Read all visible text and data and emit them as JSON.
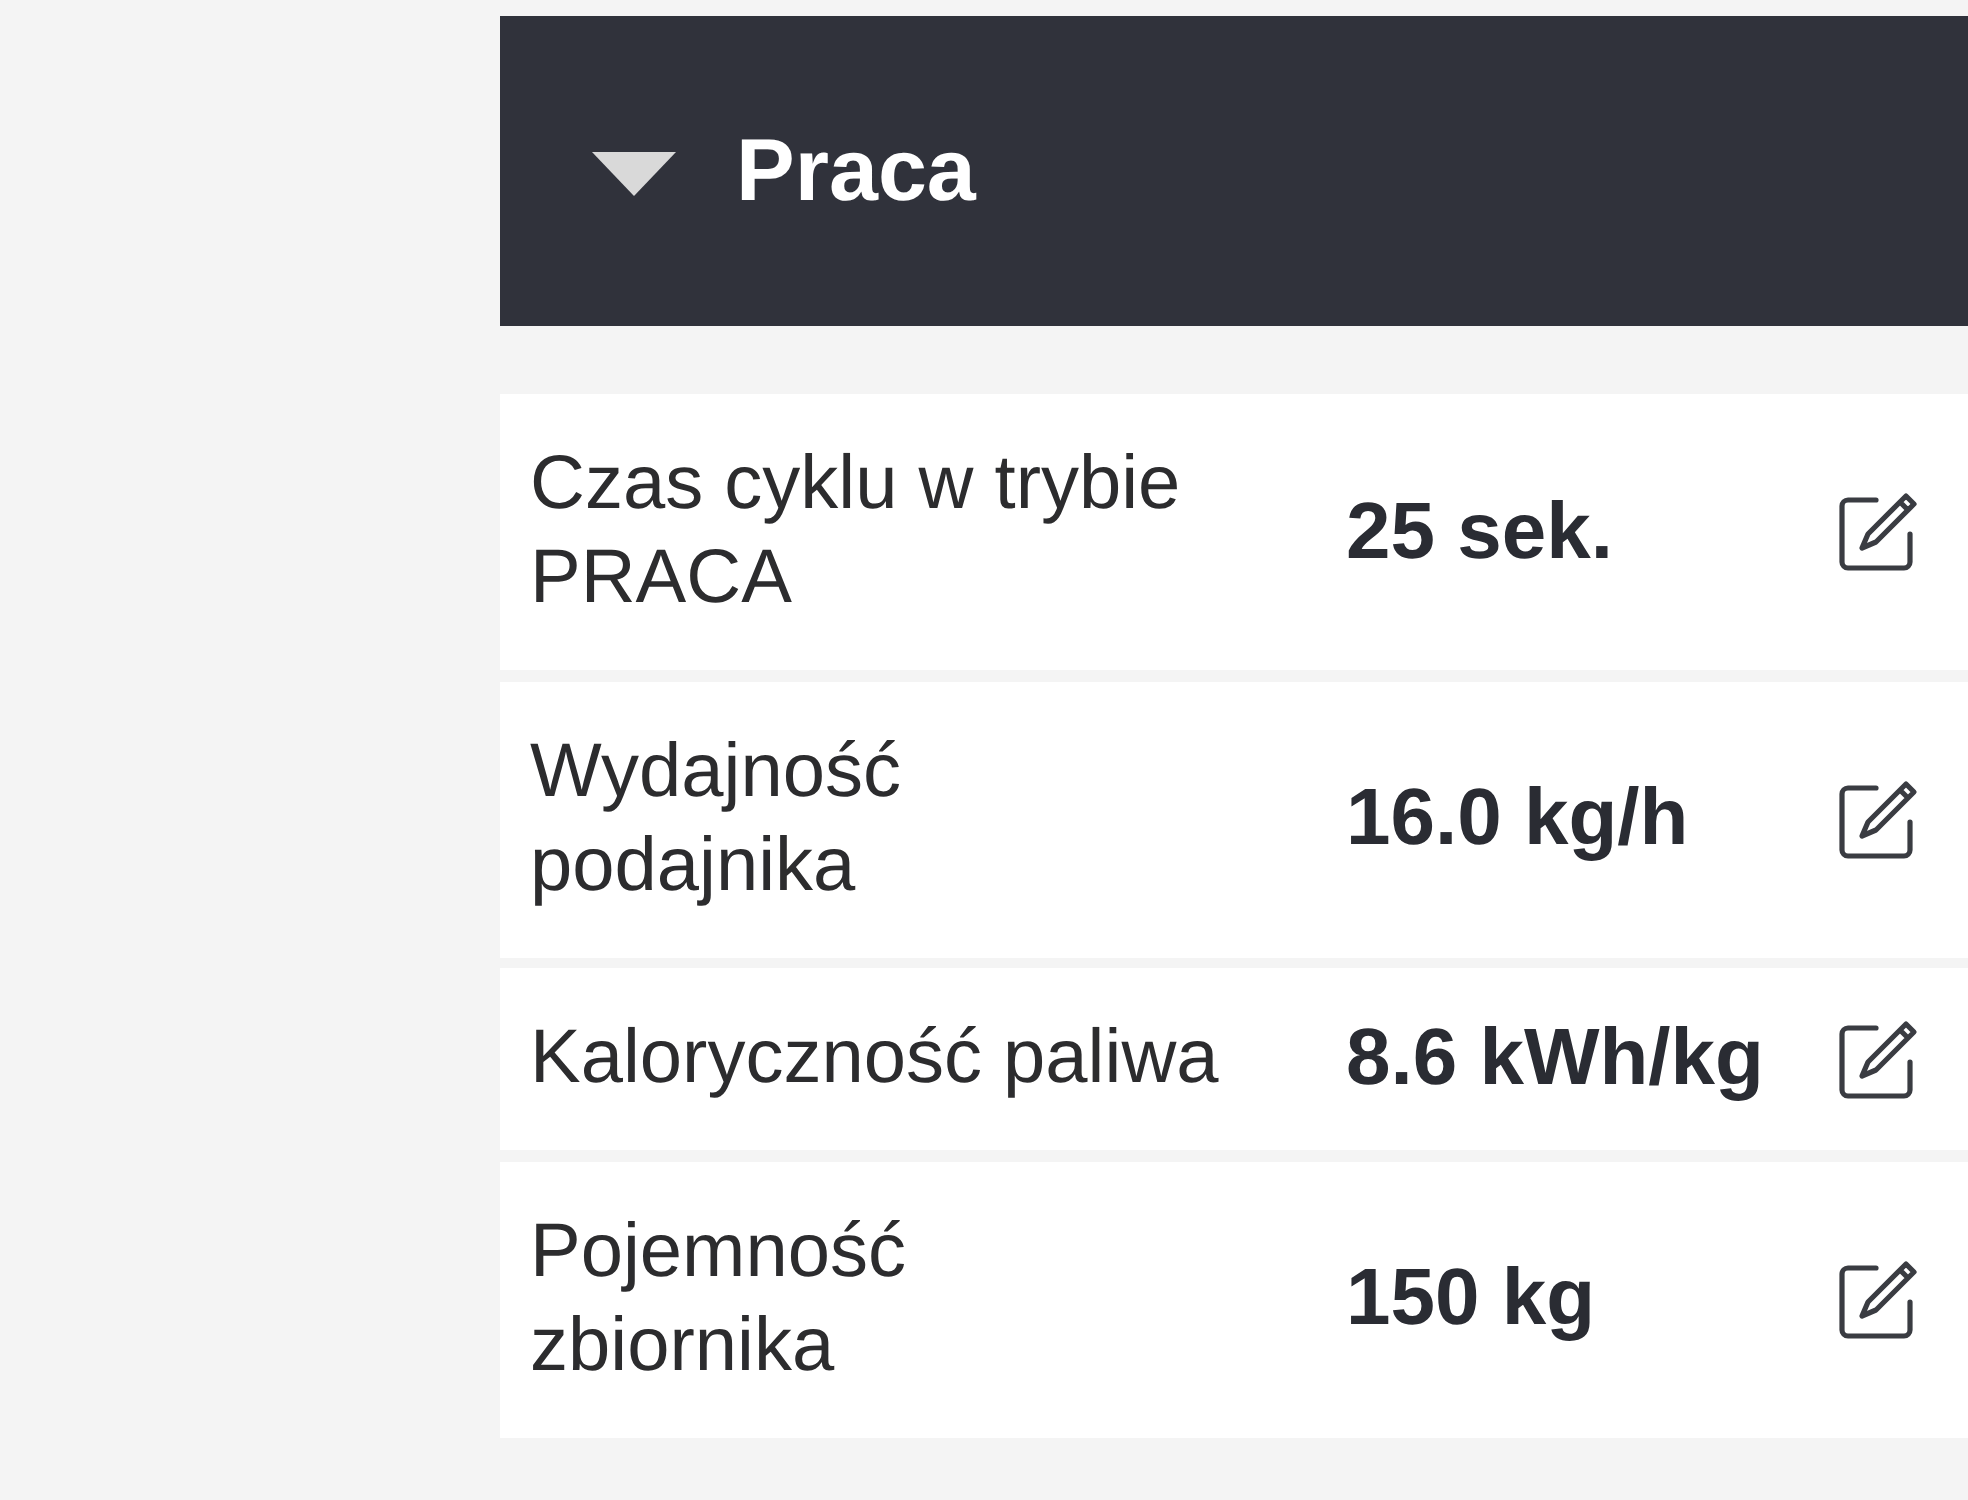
{
  "section": {
    "title": "Praca",
    "expanded": true
  },
  "rows": [
    {
      "label": "Czas cyklu w trybie PRACA",
      "value": "25 sek."
    },
    {
      "label": "Wydajność podajnika",
      "value": "16.0 kg/h"
    },
    {
      "label": "Kaloryczność paliwa",
      "value": "8.6 kWh/kg"
    },
    {
      "label": "Pojemność zbiornika",
      "value": "150 kg"
    }
  ]
}
